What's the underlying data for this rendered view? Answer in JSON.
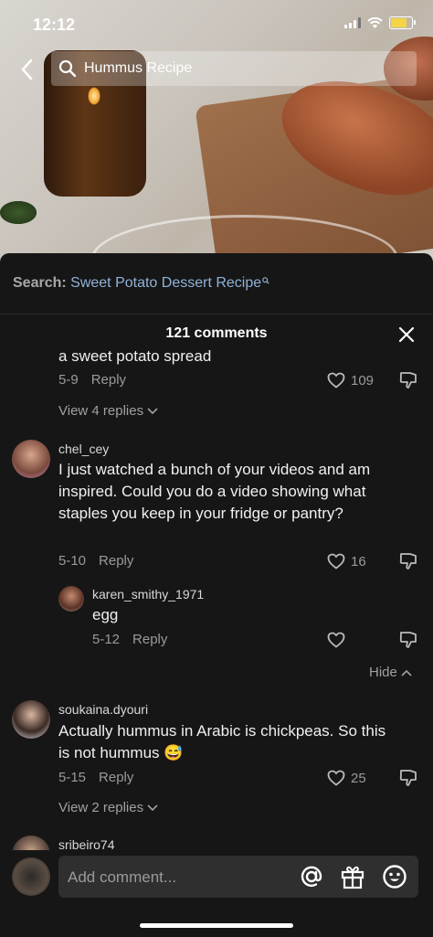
{
  "status": {
    "time": "12:12"
  },
  "search": {
    "query": "Hummus Recipe"
  },
  "suggestion": {
    "prefix": "Search:",
    "term": "Sweet Potato Dessert Recipe"
  },
  "comments": {
    "title": "121 comments",
    "partial": {
      "text": "a sweet potato spread",
      "date": "5-9",
      "reply": "Reply",
      "likes": "109",
      "view_replies": "View 4 replies"
    },
    "items": [
      {
        "username": "chel_cey",
        "text": "I just watched a bunch of your videos and am inspired. Could you do a video showing what staples you keep in your fridge or pantry?",
        "date": "5-10",
        "reply": "Reply",
        "likes": "16"
      },
      {
        "username": "karen_smithy_1971",
        "text": "egg",
        "date": "5-12",
        "reply": "Reply",
        "likes": ""
      },
      {
        "username": "soukaina.dyouri",
        "text": "Actually hummus in Arabic is chickpeas. So this is not hummus 😅",
        "date": "5-15",
        "reply": "Reply",
        "likes": "25",
        "view_replies": "View 2 replies"
      },
      {
        "username": "sribeiro74"
      }
    ],
    "hide": "Hide"
  },
  "composer": {
    "placeholder": "Add comment..."
  }
}
